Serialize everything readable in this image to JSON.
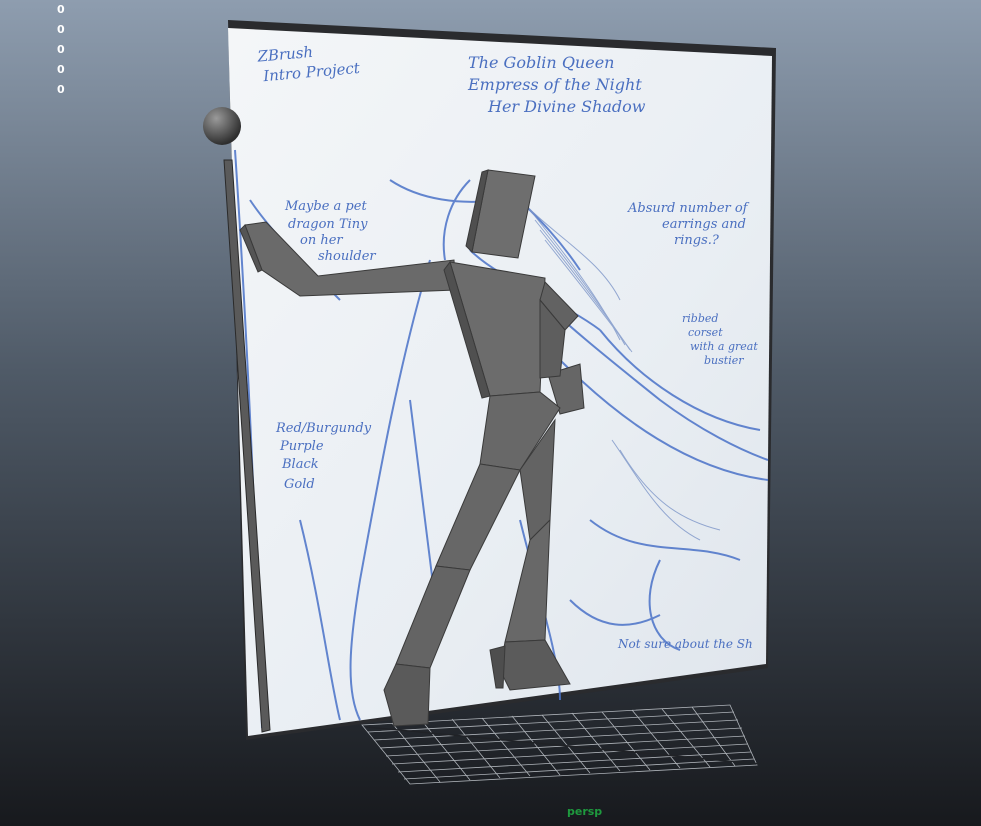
{
  "viewport": {
    "camera": "persp",
    "hud_values": [
      "0",
      "0",
      "0",
      "0",
      "0"
    ],
    "colors": {
      "bg_top": "#8e9daf",
      "bg_bottom": "#17191d",
      "mesh": "#6a6a6a",
      "sketch_ink": "#4a6fc0",
      "camera_label": "#1e9a3e"
    }
  },
  "image_plane": {
    "project_title": [
      "ZBrush",
      "Intro Project"
    ],
    "character_title": [
      "The Goblin Queen",
      "Empress of the Night",
      "Her Divine Shadow"
    ],
    "notes": {
      "pet": [
        "Maybe a pet",
        "dragon Tiny",
        "on her",
        "shoulder"
      ],
      "earrings": [
        "Absurd number of",
        "earrings and",
        "rings.?"
      ],
      "corset": [
        "ribbed",
        "corset",
        "with a great",
        "bustier"
      ],
      "colors": [
        "Red/Burgundy",
        "Purple",
        "Black",
        "Gold"
      ],
      "unsure": "Not sure about the Sh"
    }
  }
}
